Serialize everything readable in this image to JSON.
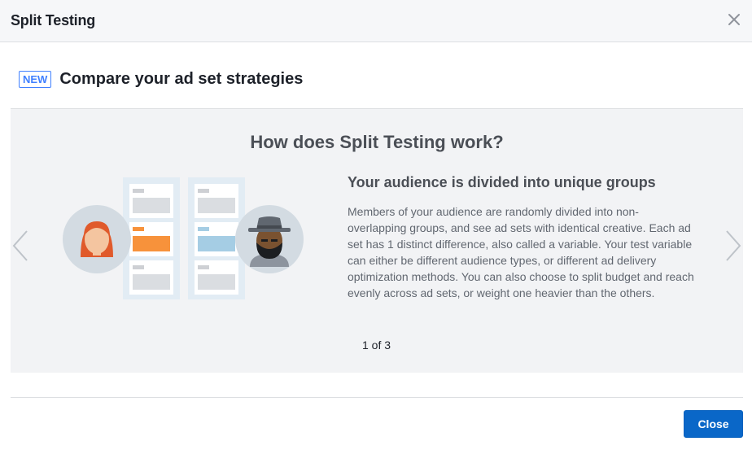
{
  "dialog": {
    "title": "Split Testing",
    "close_icon": "close-icon"
  },
  "subheader": {
    "badge": "NEW",
    "title": "Compare your ad set strategies"
  },
  "carousel": {
    "title": "How does Split Testing work?",
    "slide": {
      "heading": "Your audience is divided into unique groups",
      "body": "Members of your audience are randomly divided into non-overlapping groups, and see ad sets with identical creative. Each ad set has 1 distinct difference, also called a variable. Your test variable can either be different audience types, or different ad delivery optimization methods. You can also choose to split budget and reach evenly across ad sets, or weight one heavier than the others."
    },
    "pager": "1 of 3",
    "prev_icon": "chevron-left-icon",
    "next_icon": "chevron-right-icon"
  },
  "footer": {
    "close_label": "Close"
  },
  "colors": {
    "header_bg": "#f6f7f9",
    "panel_bg": "#f2f3f5",
    "accent": "#4080ff",
    "button": "#0a67c8",
    "orange": "#f7923b",
    "light_blue": "#a5cde4"
  }
}
